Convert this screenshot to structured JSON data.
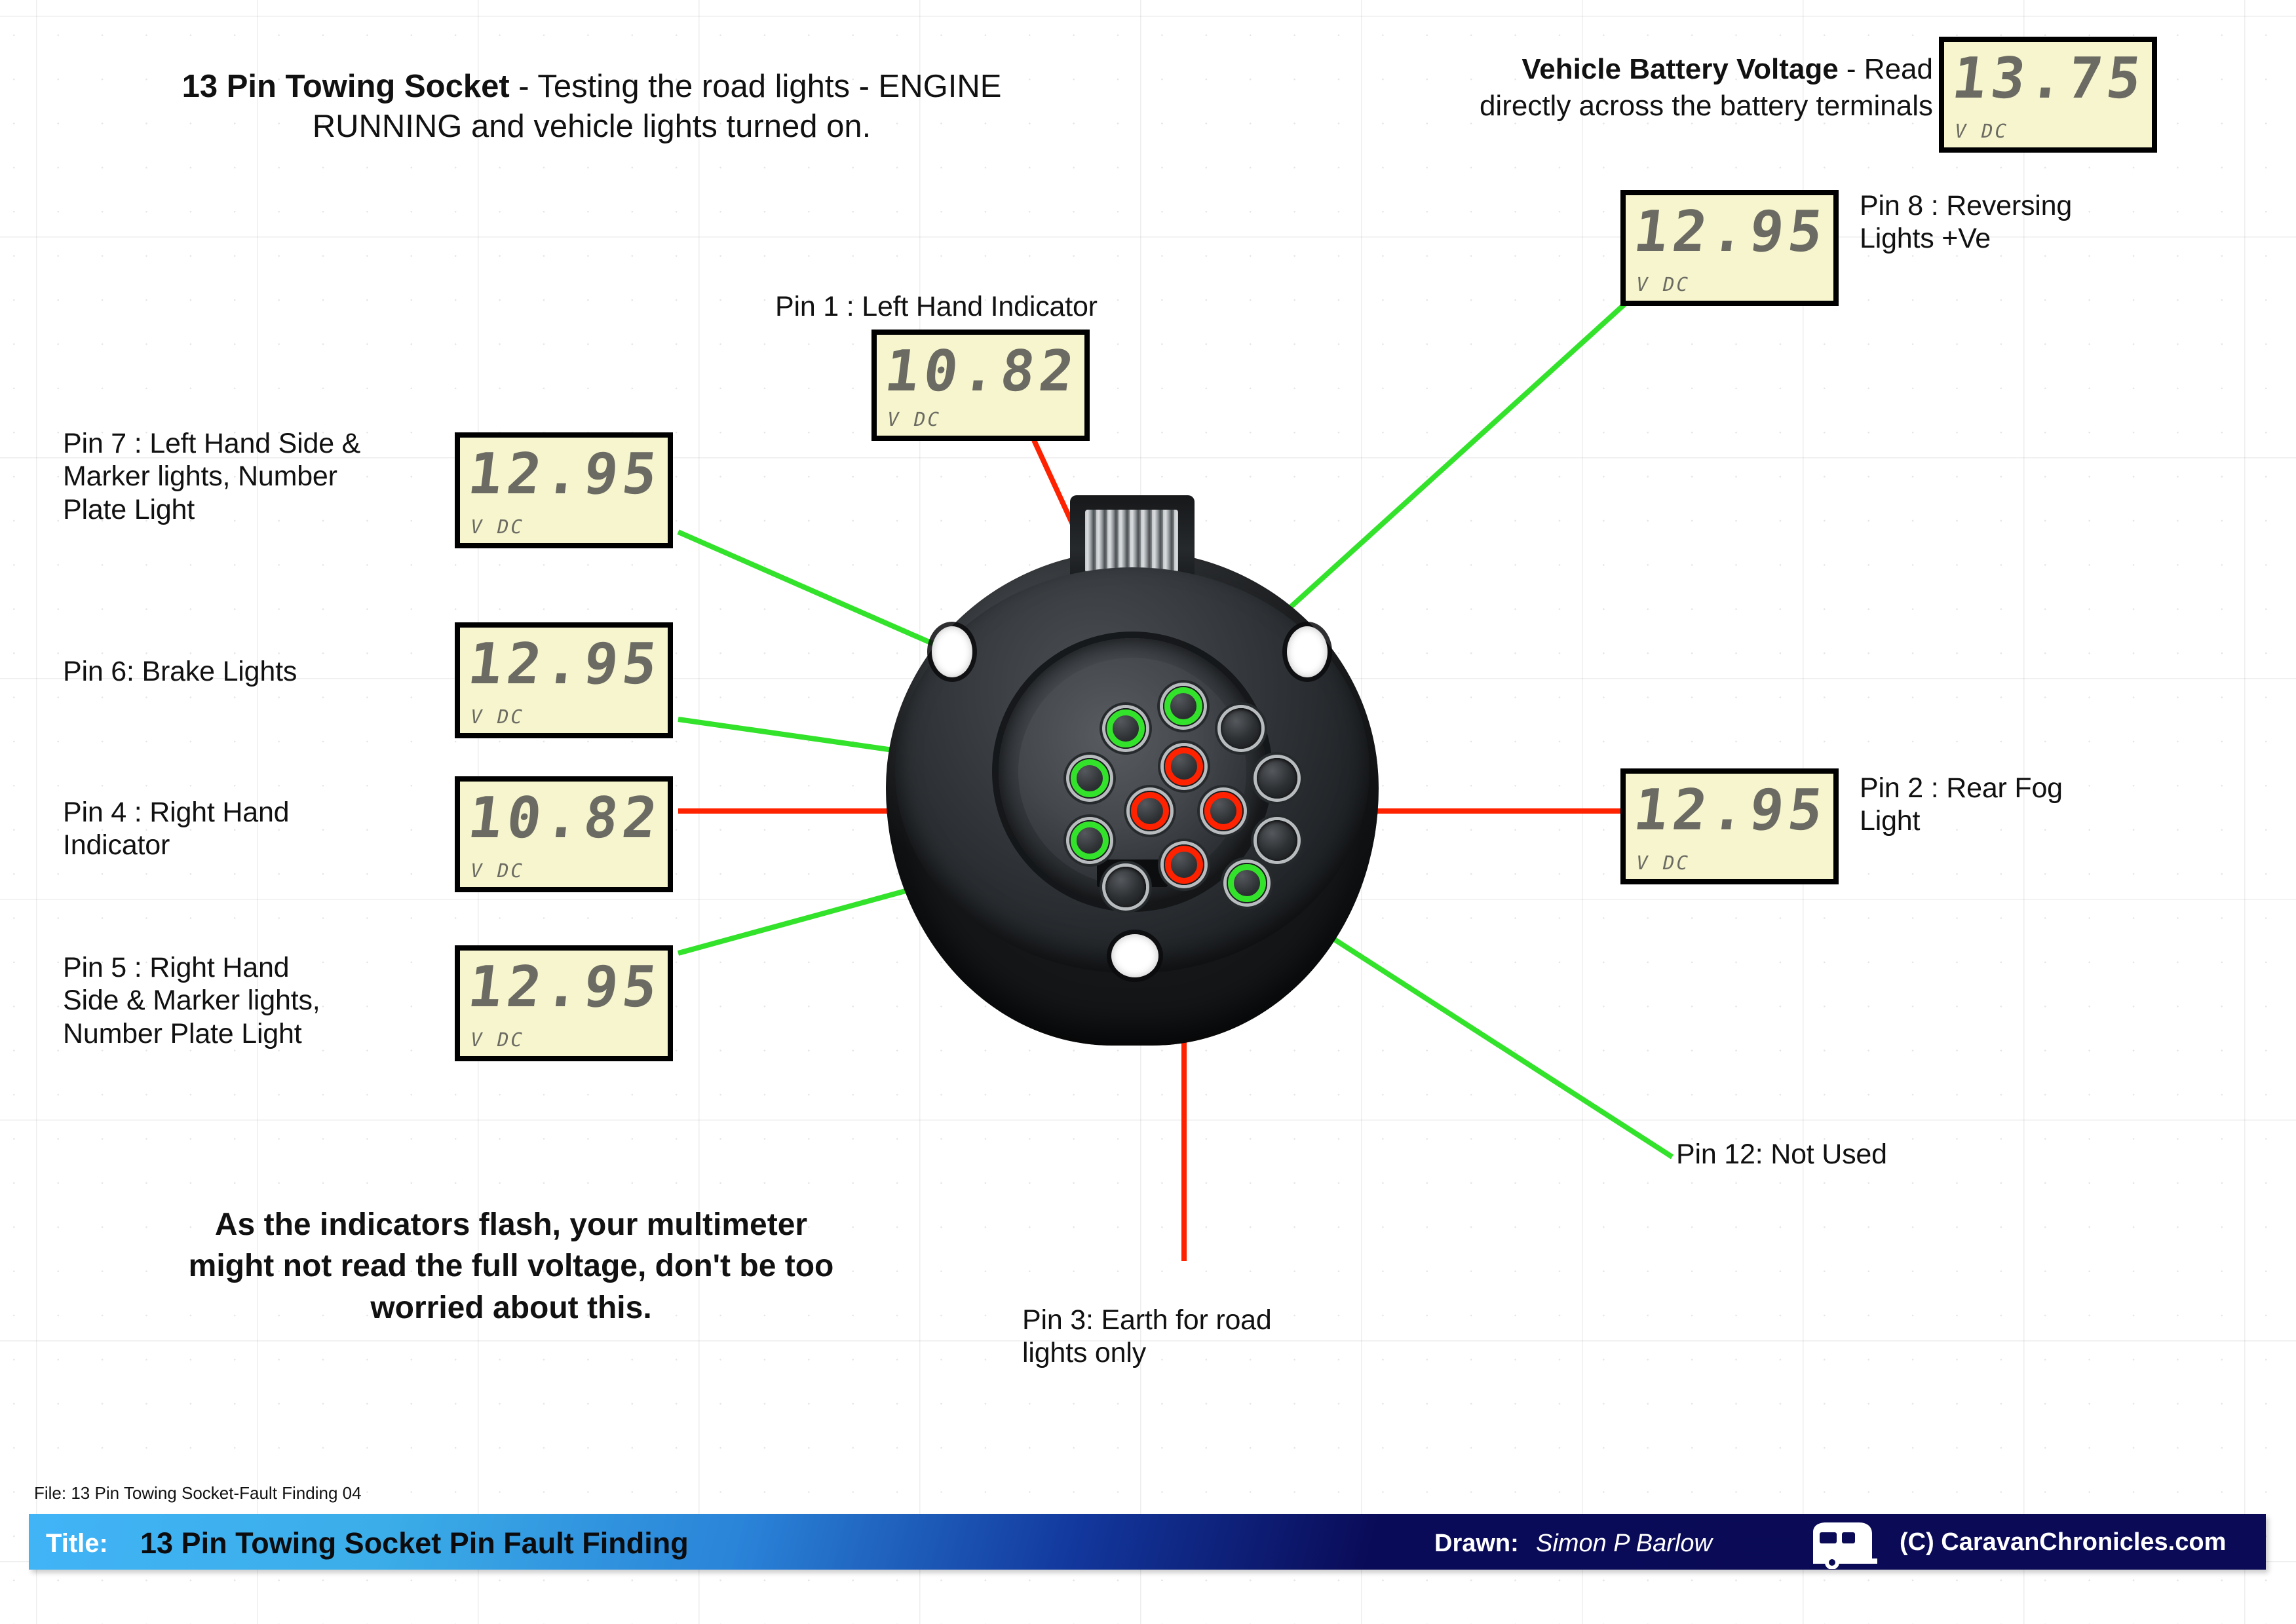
{
  "header": {
    "title_bold": "13 Pin Towing Socket",
    "title_rest": " - Testing the road lights - ENGINE",
    "title_line2": "RUNNING and vehicle lights turned on."
  },
  "battery": {
    "label_bold": "Vehicle Battery Voltage",
    "label_rest": " - Read",
    "label_line2": "directly across the battery terminals",
    "reading": "13.75",
    "units": "V  DC"
  },
  "note": {
    "line1": "As the indicators flash, your multimeter",
    "line2": "might not read the full voltage, don't be too",
    "line3": "worried about this."
  },
  "pins": [
    {
      "id": "pin1",
      "label": "Pin 1 : Left Hand Indicator",
      "reading": "10.82",
      "units": "V  DC",
      "wire": "red"
    },
    {
      "id": "pin2",
      "label_line1": "Pin 2 : Rear Fog",
      "label_line2": "Light",
      "reading": "12.95",
      "units": "V  DC",
      "wire": "red"
    },
    {
      "id": "pin3",
      "label_line1": "Pin 3: Earth for road",
      "label_line2": "lights only",
      "reading": null,
      "units": null,
      "wire": "red"
    },
    {
      "id": "pin4",
      "label_line1": "Pin 4 : Right Hand",
      "label_line2": "Indicator",
      "reading": "10.82",
      "units": "V  DC",
      "wire": "red"
    },
    {
      "id": "pin5",
      "label_line1": "Pin 5 : Right Hand",
      "label_line2": "Side & Marker lights,",
      "label_line3": "Number Plate Light",
      "reading": "12.95",
      "units": "V  DC",
      "wire": "green"
    },
    {
      "id": "pin6",
      "label": "Pin 6: Brake Lights",
      "reading": "12.95",
      "units": "V  DC",
      "wire": "green"
    },
    {
      "id": "pin7",
      "label_line1": "Pin 7 : Left Hand Side &",
      "label_line2": "Marker lights, Number",
      "label_line3": "Plate Light",
      "reading": "12.95",
      "units": "V  DC",
      "wire": "green"
    },
    {
      "id": "pin8",
      "label_line1": "Pin 8 : Reversing",
      "label_line2": "Lights +Ve",
      "reading": "12.95",
      "units": "V  DC",
      "wire": "green"
    },
    {
      "id": "pin12",
      "label": "Pin 12: Not Used",
      "reading": null,
      "units": null,
      "wire": "green"
    }
  ],
  "file_note": "File: 13 Pin Towing Socket-Fault Finding 04",
  "footer": {
    "title_label": "Title:",
    "title_value": "13 Pin Towing Socket Pin Fault Finding",
    "drawn_label": "Drawn:",
    "drawn_value": "Simon P Barlow",
    "copyright": "(C) CaravanChronicles.com",
    "logo_icon": "caravan-icon"
  },
  "colors": {
    "wire_red": "#ff2200",
    "wire_green": "#33e22a",
    "lcd_bg": "#f6f5cd",
    "lcd_segment": "#6b6b63",
    "footer_light": "#41b4f7",
    "footer_dark": "#0a0a56"
  }
}
